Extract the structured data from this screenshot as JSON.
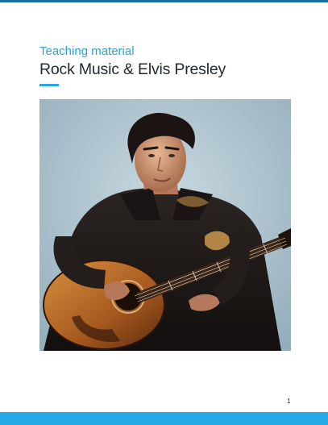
{
  "document": {
    "subtitle": "Teaching material",
    "title": "Rock Music & Elvis Presley",
    "page_number": "1"
  },
  "colors": {
    "accent": "#27a6e0",
    "top_rule": "#1b6fa3",
    "bottom_bar": "#25a8e6",
    "title_text": "#1f2a33",
    "subtitle_text": "#2aa3da"
  },
  "image": {
    "subject": "portrait of a man in a dark leather jacket playing an acoustic guitar"
  }
}
